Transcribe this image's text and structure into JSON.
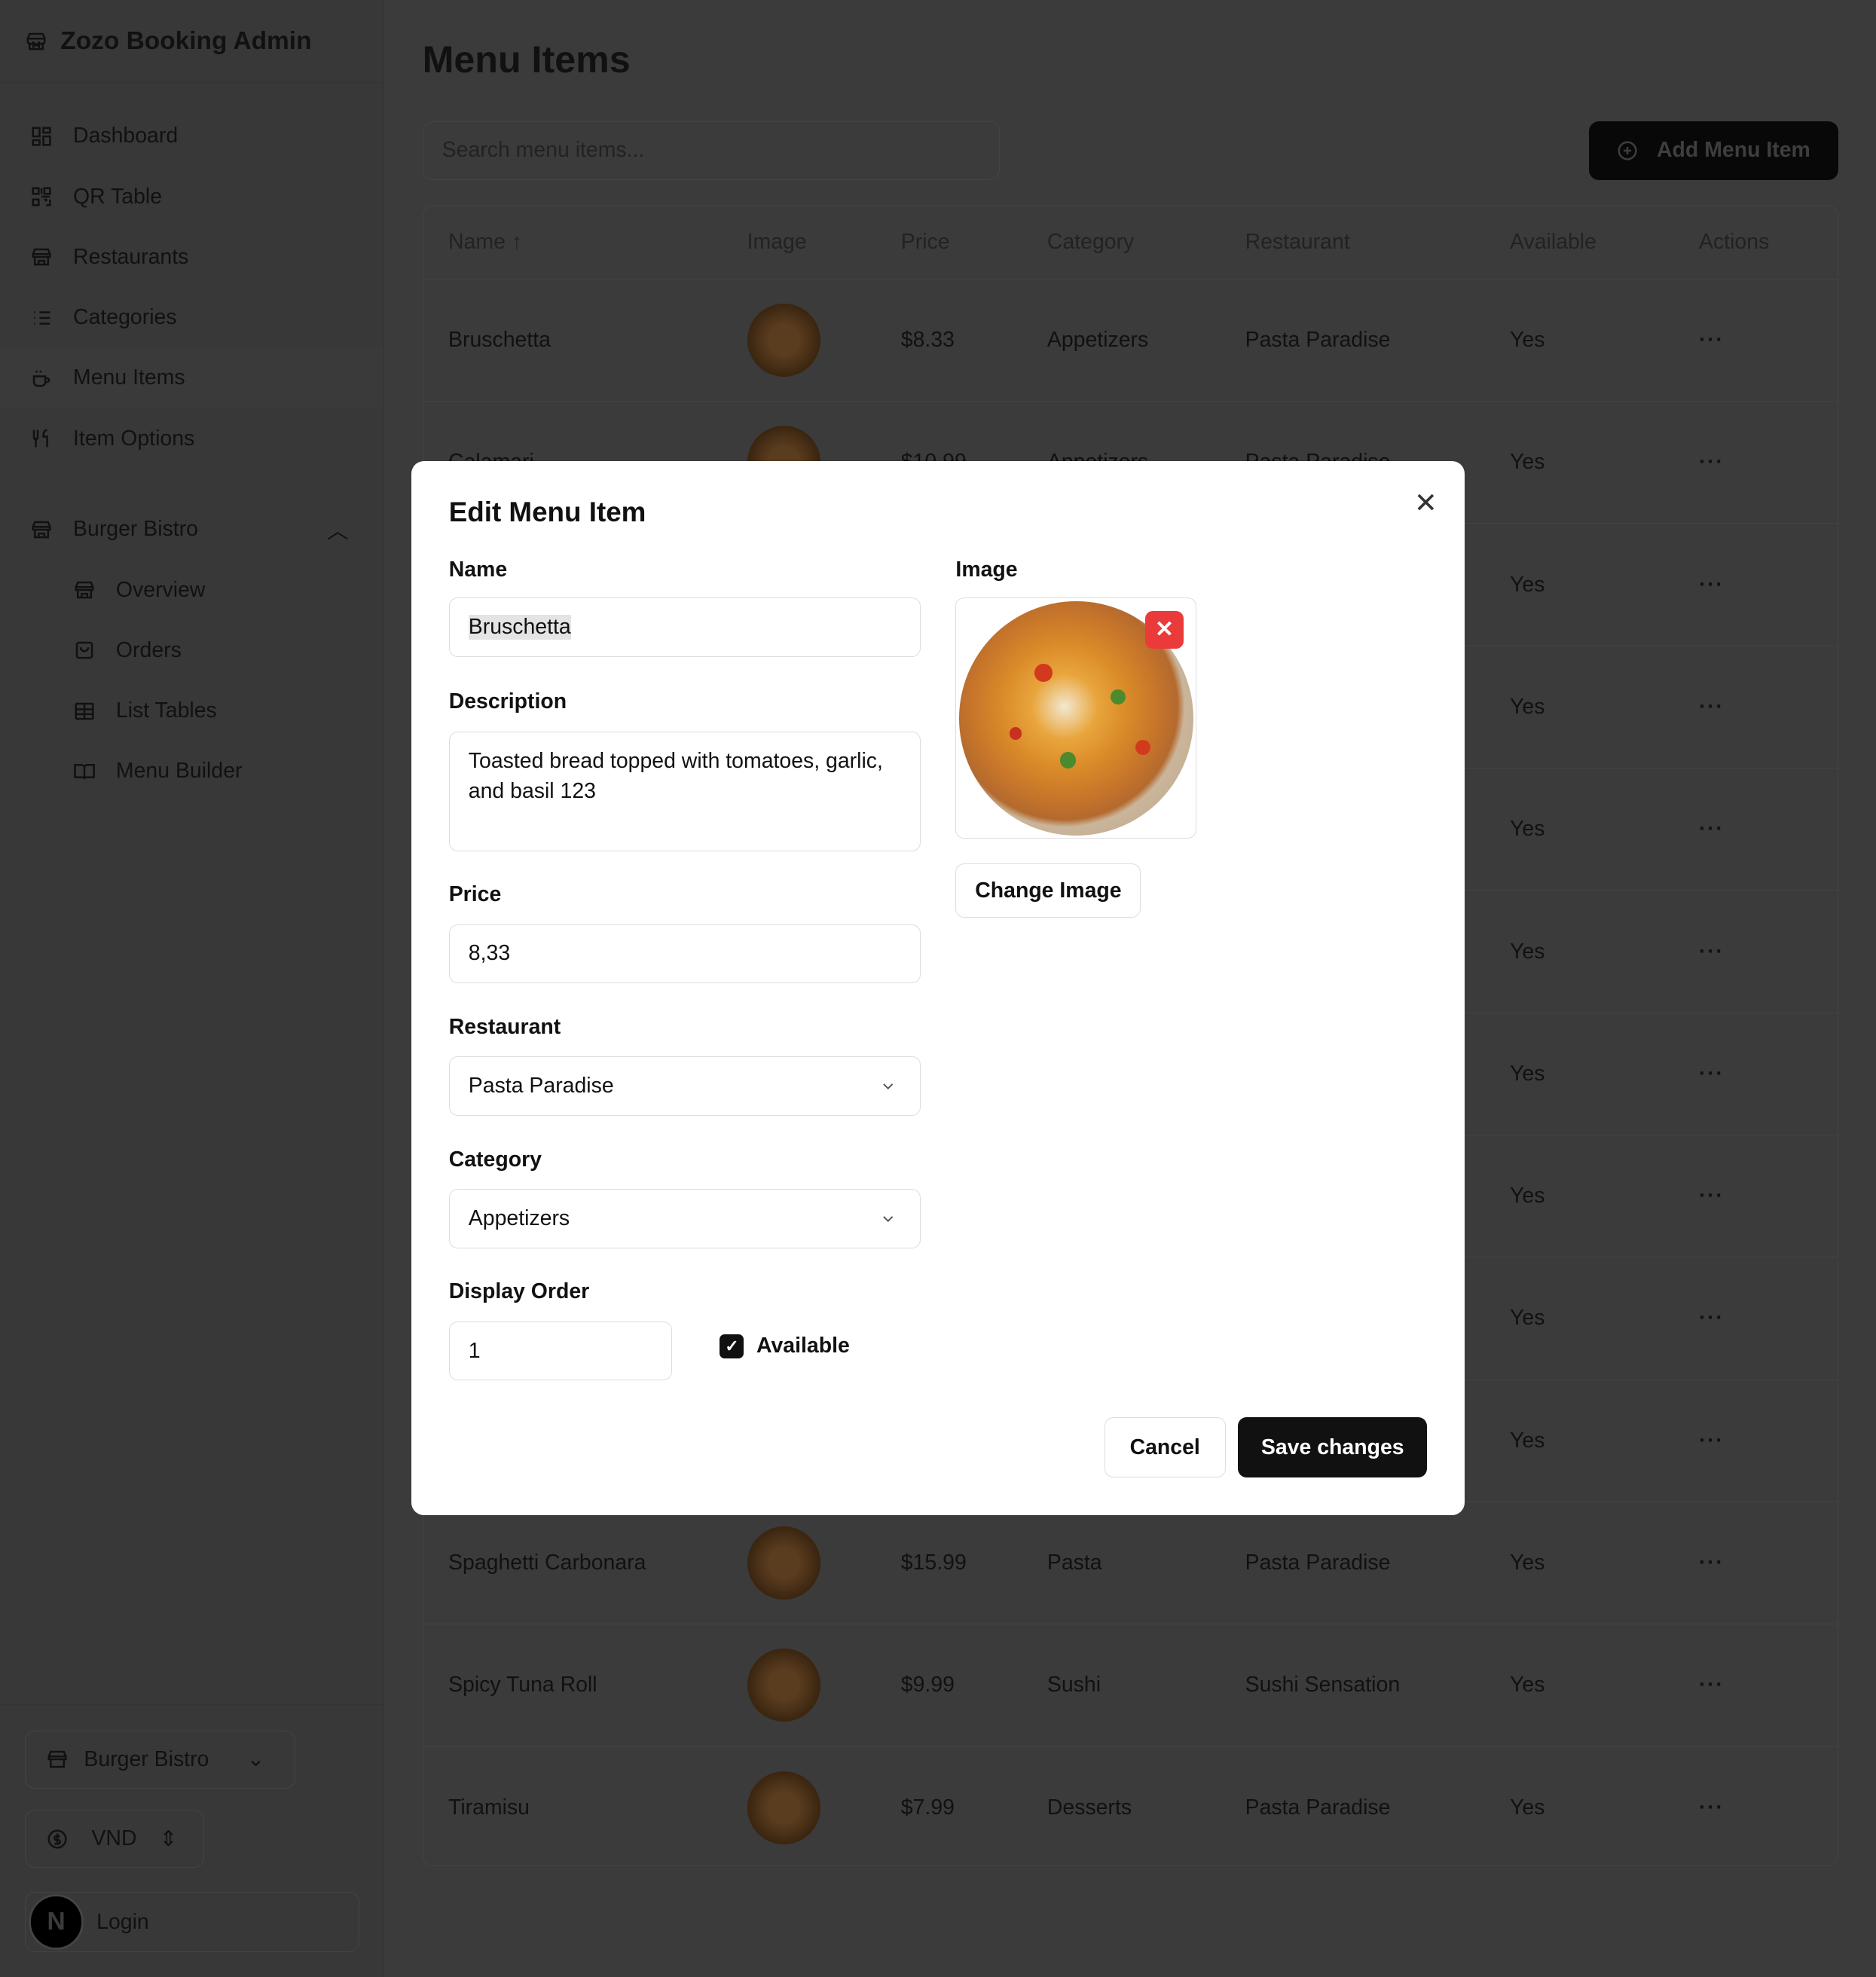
{
  "sidebar": {
    "brand": "Zozo Booking Admin",
    "items": [
      {
        "label": "Dashboard",
        "icon": "dashboard-icon"
      },
      {
        "label": "QR Table",
        "icon": "qr-icon"
      },
      {
        "label": "Restaurants",
        "icon": "store-icon"
      },
      {
        "label": "Categories",
        "icon": "list-icon"
      },
      {
        "label": "Menu Items",
        "icon": "coffee-icon"
      },
      {
        "label": "Item Options",
        "icon": "utensils-icon"
      }
    ],
    "group": {
      "label": "Burger Bistro",
      "items": [
        {
          "label": "Overview"
        },
        {
          "label": "Orders"
        },
        {
          "label": "List Tables"
        },
        {
          "label": "Menu Builder"
        }
      ]
    },
    "restaurant_select": "Burger Bistro",
    "currency_select": "VND",
    "avatar_letter": "N",
    "login": "Login"
  },
  "main": {
    "title": "Menu Items",
    "search_placeholder": "Search menu items...",
    "add_label": "Add Menu Item",
    "columns": [
      "Name ↑",
      "Image",
      "Price",
      "Category",
      "Restaurant",
      "Available",
      "Actions"
    ],
    "rows": [
      {
        "name": "Bruschetta",
        "price": "$8.33",
        "category": "Appetizers",
        "restaurant": "Pasta Paradise",
        "available": "Yes"
      },
      {
        "name": "Calamari",
        "price": "$10.99",
        "category": "Appetizers",
        "restaurant": "Pasta Paradise",
        "available": "Yes"
      },
      {
        "name": "",
        "price": "",
        "category": "",
        "restaurant": "",
        "available": "Yes"
      },
      {
        "name": "",
        "price": "",
        "category": "",
        "restaurant": "",
        "available": "Yes"
      },
      {
        "name": "",
        "price": "",
        "category": "",
        "restaurant": "",
        "available": "Yes"
      },
      {
        "name": "",
        "price": "",
        "category": "",
        "restaurant": "",
        "available": "Yes"
      },
      {
        "name": "",
        "price": "",
        "category": "",
        "restaurant": "",
        "available": "Yes"
      },
      {
        "name": "",
        "price": "",
        "category": "",
        "restaurant": "",
        "available": "Yes"
      },
      {
        "name": "",
        "price": "",
        "category": "",
        "restaurant": "",
        "available": "Yes"
      },
      {
        "name": "",
        "price": "",
        "category": "",
        "restaurant": "",
        "available": "Yes"
      },
      {
        "name": "Spaghetti Carbonara",
        "price": "$15.99",
        "category": "Pasta",
        "restaurant": "Pasta Paradise",
        "available": "Yes"
      },
      {
        "name": "Spicy Tuna Roll",
        "price": "$9.99",
        "category": "Sushi",
        "restaurant": "Sushi Sensation",
        "available": "Yes"
      },
      {
        "name": "Tiramisu",
        "price": "$7.99",
        "category": "Desserts",
        "restaurant": "Pasta Paradise",
        "available": "Yes"
      }
    ]
  },
  "modal": {
    "title": "Edit Menu Item",
    "name_label": "Name",
    "name_value": "Bruschetta",
    "description_label": "Description",
    "description_value": "Toasted bread topped with tomatoes, garlic, and basil 123",
    "price_label": "Price",
    "price_value": "8,33",
    "restaurant_label": "Restaurant",
    "restaurant_value": "Pasta Paradise",
    "category_label": "Category",
    "category_value": "Appetizers",
    "display_order_label": "Display Order",
    "display_order_value": "1",
    "available_label": "Available",
    "available_checked": true,
    "image_label": "Image",
    "change_image": "Change Image",
    "cancel": "Cancel",
    "save": "Save changes"
  },
  "colors": {
    "accent": "#111111",
    "remove": "#ea3a3a"
  }
}
